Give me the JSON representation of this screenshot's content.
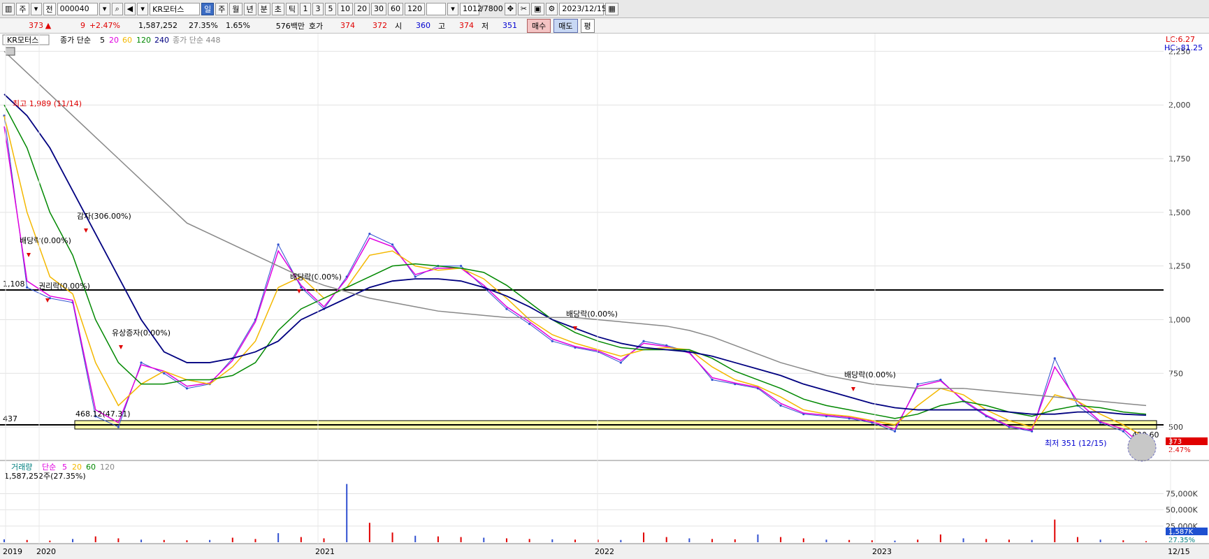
{
  "toolbar": {
    "mode": "주",
    "type": "전",
    "code": "000040",
    "name": "KR모터스",
    "periods": [
      "일",
      "주",
      "월",
      "년",
      "분",
      "초",
      "틱"
    ],
    "active_period": "일",
    "intervals": [
      "1",
      "3",
      "5",
      "10",
      "20",
      "30",
      "60",
      "120"
    ],
    "count": "1012",
    "total": "/7800",
    "date": "2023/12/15"
  },
  "quote": {
    "price": "373",
    "change": "9",
    "rate": "+2.47%",
    "volume": "1,587,252",
    "vol_ratio": "27.35%",
    "turnover": "1.65%",
    "amount": "576백만",
    "bid_label": "호가",
    "ask": "374",
    "bid": "372",
    "open_label": "시",
    "open": "360",
    "high_label": "고",
    "high": "374",
    "low_label": "저",
    "low": "351",
    "buy": "매수",
    "sell": "매도",
    "avg": "평"
  },
  "price_panel": {
    "name": "KR모터스",
    "ma_label": "종가 단순",
    "ma_periods": [
      "5",
      "20",
      "60",
      "120",
      "240"
    ],
    "ma_colors": [
      "#e000e0",
      "#f4b800",
      "#008800",
      "#000080"
    ],
    "long_ma_label": "종가 단순 448",
    "lc": "LC:6.27",
    "hc": "HC:-81.25",
    "current_price_label": "373",
    "current_rate_label": "2.47%",
    "level_1108": "1,108",
    "level_437": "437",
    "max_label": "최고 1,989 (11/14)",
    "min_label": "최저 351 (12/15)",
    "range_label": "468.12(47.31)",
    "band_label": "420.60",
    "events": [
      "배당락(0.00%)",
      "감자(306.00%)",
      "권리락(0.00%)",
      "유상증자(0.00%)",
      "배당락(0.00%)",
      "배당락(0.00%)",
      "배당락(0.00%)"
    ]
  },
  "volume_panel": {
    "label": "거래량",
    "ma_label": "단순",
    "ma_periods": [
      "5",
      "20",
      "60",
      "120"
    ],
    "value_label": "1,587,252주(27.35%)",
    "current_label": "1,587K",
    "current_pct": "27.35%"
  },
  "x_labels": [
    "2019",
    "2020",
    "2021",
    "2022",
    "2023",
    "12/15"
  ],
  "chart_data": {
    "type": "line",
    "title": "",
    "x": [
      "2019-10",
      "2019-11",
      "2019-12",
      "2020-01",
      "2020-02",
      "2020-03",
      "2020-04",
      "2020-05",
      "2020-06",
      "2020-07",
      "2020-08",
      "2020-09",
      "2020-10",
      "2020-11",
      "2020-12",
      "2021-01",
      "2021-02",
      "2021-03",
      "2021-04",
      "2021-05",
      "2021-06",
      "2021-07",
      "2021-08",
      "2021-09",
      "2021-10",
      "2021-11",
      "2021-12",
      "2022-01",
      "2022-02",
      "2022-03",
      "2022-04",
      "2022-05",
      "2022-06",
      "2022-07",
      "2022-08",
      "2022-09",
      "2022-10",
      "2022-11",
      "2022-12",
      "2023-01",
      "2023-02",
      "2023-03",
      "2023-04",
      "2023-05",
      "2023-06",
      "2023-07",
      "2023-08",
      "2023-09",
      "2023-10",
      "2023-11",
      "2023-12"
    ],
    "series": [
      {
        "name": "종가",
        "values": [
          1950,
          1150,
          1100,
          1080,
          550,
          500,
          800,
          750,
          680,
          700,
          820,
          1000,
          1350,
          1150,
          1050,
          1200,
          1400,
          1350,
          1200,
          1250,
          1250,
          1150,
          1050,
          980,
          900,
          870,
          850,
          800,
          900,
          880,
          850,
          720,
          700,
          680,
          600,
          560,
          550,
          540,
          520,
          480,
          700,
          720,
          620,
          550,
          500,
          480,
          820,
          600,
          520,
          480,
          373
        ]
      },
      {
        "name": "5",
        "values": [
          1900,
          1180,
          1110,
          1090,
          580,
          520,
          790,
          760,
          690,
          705,
          810,
          990,
          1320,
          1160,
          1060,
          1190,
          1380,
          1340,
          1210,
          1240,
          1240,
          1160,
          1060,
          990,
          910,
          875,
          855,
          810,
          890,
          875,
          845,
          730,
          705,
          685,
          610,
          565,
          555,
          545,
          525,
          490,
          690,
          715,
          625,
          555,
          505,
          485,
          780,
          620,
          525,
          490,
          400
        ]
      },
      {
        "name": "20",
        "values": [
          1950,
          1500,
          1200,
          1120,
          800,
          600,
          700,
          760,
          720,
          700,
          780,
          900,
          1150,
          1200,
          1100,
          1150,
          1300,
          1320,
          1250,
          1230,
          1240,
          1190,
          1100,
          1000,
          930,
          890,
          860,
          830,
          860,
          870,
          860,
          780,
          720,
          690,
          640,
          580,
          560,
          550,
          530,
          510,
          600,
          680,
          650,
          580,
          530,
          500,
          650,
          620,
          560,
          510,
          450
        ]
      },
      {
        "name": "60",
        "values": [
          2000,
          1800,
          1500,
          1300,
          1000,
          800,
          700,
          700,
          720,
          720,
          740,
          800,
          950,
          1050,
          1100,
          1150,
          1200,
          1250,
          1260,
          1250,
          1240,
          1220,
          1160,
          1080,
          1000,
          940,
          900,
          870,
          860,
          860,
          860,
          820,
          760,
          720,
          680,
          630,
          600,
          580,
          560,
          540,
          560,
          600,
          620,
          600,
          570,
          550,
          580,
          600,
          590,
          570,
          560
        ]
      },
      {
        "name": "120",
        "values": [
          2050,
          1950,
          1800,
          1600,
          1400,
          1200,
          1000,
          850,
          800,
          800,
          820,
          850,
          900,
          1000,
          1050,
          1100,
          1150,
          1180,
          1190,
          1190,
          1180,
          1150,
          1110,
          1060,
          1000,
          960,
          920,
          890,
          870,
          860,
          850,
          830,
          800,
          770,
          740,
          700,
          670,
          640,
          610,
          590,
          580,
          580,
          580,
          580,
          570,
          560,
          560,
          570,
          570,
          560,
          555
        ]
      },
      {
        "name": "448",
        "values": [
          2250,
          2150,
          2050,
          1950,
          1850,
          1750,
          1650,
          1550,
          1450,
          1400,
          1350,
          1300,
          1250,
          1200,
          1160,
          1130,
          1100,
          1080,
          1060,
          1040,
          1030,
          1020,
          1010,
          1010,
          1010,
          1010,
          1000,
          990,
          980,
          970,
          950,
          920,
          880,
          840,
          800,
          770,
          740,
          720,
          700,
          690,
          680,
          680,
          680,
          670,
          660,
          650,
          640,
          630,
          620,
          610,
          600
        ]
      }
    ],
    "yticks": [
      500,
      750,
      1000,
      1250,
      1500,
      1750,
      2000,
      2250
    ],
    "ylim": [
      380,
      2300
    ],
    "volume": [
      4500,
      3500,
      2500,
      5000,
      9000,
      6000,
      4000,
      3500,
      3000,
      3500,
      7000,
      5000,
      14000,
      8000,
      6000,
      90000,
      30000,
      15000,
      10000,
      9000,
      8000,
      7000,
      6000,
      5000,
      4500,
      4000,
      4000,
      3500,
      15000,
      8000,
      6000,
      5000,
      4500,
      12000,
      8000,
      6000,
      4000,
      3500,
      3000,
      2500,
      4000,
      12000,
      6000,
      5000,
      4000,
      3500,
      35000,
      8000,
      4000,
      3000,
      1587
    ],
    "vol_yticks": [
      "25,000K",
      "50,000K",
      "75,000K"
    ],
    "vol_ylim": [
      0,
      95000
    ],
    "grid": true
  }
}
